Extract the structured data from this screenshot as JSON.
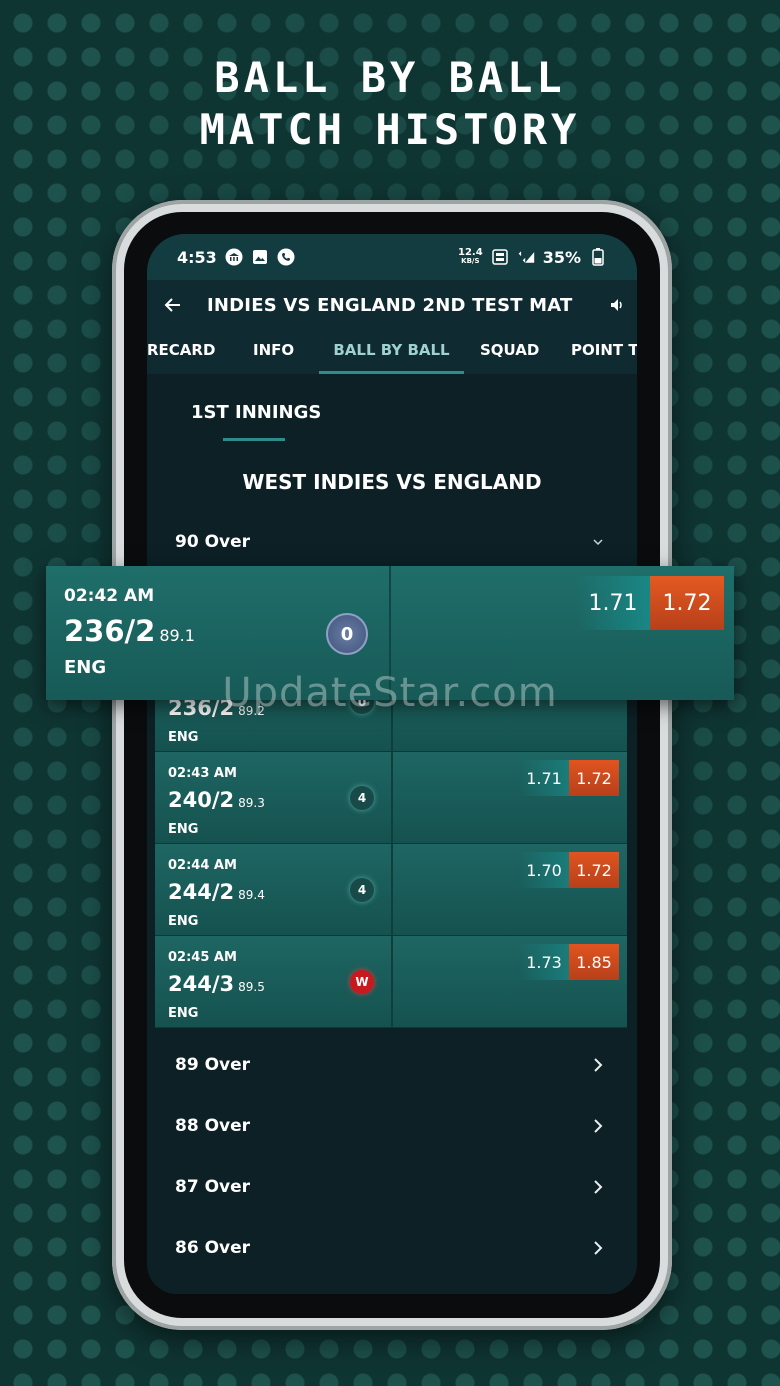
{
  "promo": {
    "line1": "BALL BY BALL",
    "line2": "MATCH HISTORY"
  },
  "watermark": "UpdateStar.com",
  "status_bar": {
    "time": "4:53",
    "net_speed": "12.4",
    "net_unit": "KB/S",
    "battery": "35%"
  },
  "app_bar": {
    "title": "INDIES VS ENGLAND 2ND TEST MAT"
  },
  "tabs": [
    {
      "label": "RECARD"
    },
    {
      "label": "INFO"
    },
    {
      "label": "BALL BY BALL"
    },
    {
      "label": "SQUAD"
    },
    {
      "label": "POINT T"
    }
  ],
  "innings": {
    "label": "1ST INNINGS"
  },
  "match_title": "WEST INDIES VS ENGLAND",
  "current_over": {
    "label": "90 Over"
  },
  "highlight_ball": {
    "time": "02:42 AM",
    "score": "236/2",
    "over": "89.1",
    "team": "ENG",
    "ball": "0",
    "back": "1.71",
    "lay": "1.72"
  },
  "partial_ball": {
    "score": "236/2",
    "over": "89.2",
    "team": "ENG",
    "ball": "0"
  },
  "balls": [
    {
      "time": "02:43 AM",
      "score": "240/2",
      "over": "89.3",
      "team": "ENG",
      "ball": "4",
      "back": "1.71",
      "lay": "1.72"
    },
    {
      "time": "02:44 AM",
      "score": "244/2",
      "over": "89.4",
      "team": "ENG",
      "ball": "4",
      "back": "1.70",
      "lay": "1.72"
    },
    {
      "time": "02:45 AM",
      "score": "244/3",
      "over": "89.5",
      "team": "ENG",
      "ball": "W",
      "back": "1.73",
      "lay": "1.85"
    }
  ],
  "previous_overs": [
    {
      "label": "89 Over"
    },
    {
      "label": "88 Over"
    },
    {
      "label": "87 Over"
    },
    {
      "label": "86 Over"
    }
  ],
  "colors": {
    "accent": "#2e8d8a",
    "lay": "#e05420",
    "wicket": "#c8191e",
    "card": "#1e6663"
  }
}
